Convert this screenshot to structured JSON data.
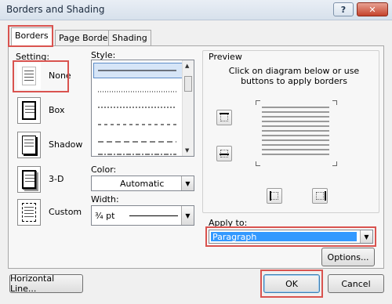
{
  "window": {
    "title": "Borders and Shading",
    "help_label": "?",
    "close_label": "✕"
  },
  "tabs": [
    {
      "label": "Borders",
      "active": true
    },
    {
      "label": "Page Border",
      "active": false
    },
    {
      "label": "Shading",
      "active": false
    }
  ],
  "setting": {
    "label": "Setting:",
    "items": [
      {
        "label": "None",
        "selected": true
      },
      {
        "label": "Box",
        "selected": false
      },
      {
        "label": "Shadow",
        "selected": false
      },
      {
        "label": "3-D",
        "selected": false
      },
      {
        "label": "Custom",
        "selected": false
      }
    ]
  },
  "style": {
    "label": "Style:",
    "items": [
      "solid",
      "dotted",
      "dash-dot small",
      "dashed",
      "dash long",
      "dash-dot"
    ]
  },
  "color": {
    "label": "Color:",
    "value": "Automatic"
  },
  "width": {
    "label": "Width:",
    "value": "¾ pt"
  },
  "preview": {
    "label": "Preview",
    "instruction": "Click on diagram below or use buttons to apply borders"
  },
  "apply_to": {
    "label": "Apply to:",
    "value": "Paragraph"
  },
  "buttons": {
    "options": "Options...",
    "horizontal_line": "Horizontal Line...",
    "ok": "OK",
    "cancel": "Cancel"
  },
  "colors": {
    "highlight": "#d9534f",
    "selection": "#3399ff"
  }
}
